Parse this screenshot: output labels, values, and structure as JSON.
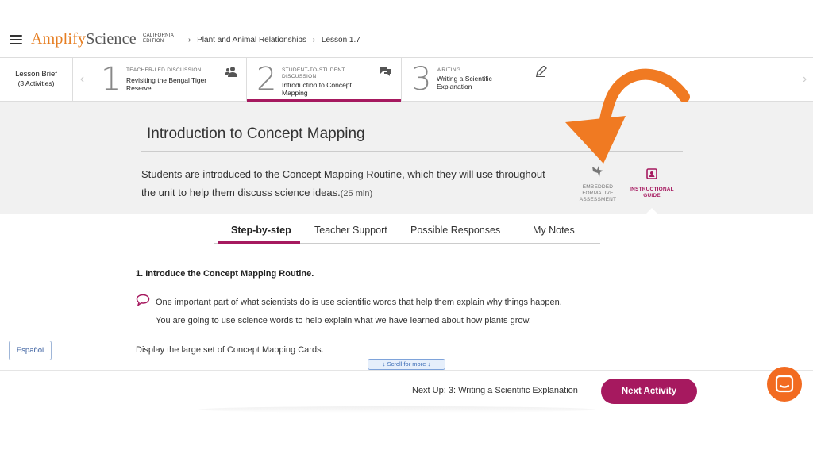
{
  "header": {
    "logo_amplify": "Amplify",
    "logo_science": "Science",
    "logo_edition_line1": "CALIFORNIA",
    "logo_edition_line2": "EDITION",
    "breadcrumbs": [
      "Plant and Animal Relationships",
      "Lesson 1.7"
    ]
  },
  "activity_strip": {
    "lesson_brief_title": "Lesson Brief",
    "lesson_brief_count": "(3 Activities)",
    "prev_icon": "chevron-left-icon",
    "next_icon": "chevron-right-icon",
    "activities": [
      {
        "number": "1",
        "type_line1": "TEACHER-LED DISCUSSION",
        "type_line2": "",
        "name_line1": "Revisiting the Bengal Tiger",
        "name_line2": "Reserve",
        "icon": "people-icon"
      },
      {
        "number": "2",
        "type_line1": "STUDENT-TO-STUDENT",
        "type_line2": "DISCUSSION",
        "name_line1": "Introduction to Concept",
        "name_line2": "Mapping",
        "icon": "speech-bubbles-icon"
      },
      {
        "number": "3",
        "type_line1": "WRITING",
        "type_line2": "",
        "name_line1": "Writing a Scientific",
        "name_line2": "Explanation",
        "icon": "pencil-icon"
      }
    ]
  },
  "activity_header": {
    "title": "Introduction to Concept Mapping",
    "description": "Students are introduced to the Concept Mapping Routine, which they will use throughout the unit to help them discuss science ideas.",
    "duration": "(25 min)",
    "embedded_assessment_line1": "EMBEDDED",
    "embedded_assessment_line2": "FORMATIVE",
    "embedded_assessment_line3": "ASSESSMENT",
    "instructional_guide_line1": "INSTRUCTIONAL",
    "instructional_guide_line2": "GUIDE"
  },
  "tabs": [
    "Step-by-step",
    "Teacher Support",
    "Possible Responses",
    "My Notes"
  ],
  "content": {
    "step_title": "1. Introduce the Concept Mapping Routine.",
    "say_line1": "One important part of what scientists do is use scientific words that help them explain why things happen.",
    "say_line2": "You are going to use science words to help explain what we have learned about how plants grow.",
    "display_line": "Display the large set of Concept Mapping Cards.",
    "scroll_more": "Scroll for more"
  },
  "side": {
    "espanol": "Español"
  },
  "footer": {
    "next_up": "Next Up: 3: Writing a Scientific Explanation",
    "next_button": "Next Activity"
  },
  "colors": {
    "accent": "#a6195f",
    "brand_orange": "#e67e22",
    "annotation_arrow": "#f07a22",
    "chat_button": "#f26b21",
    "gray_band": "#f1f1f1"
  }
}
